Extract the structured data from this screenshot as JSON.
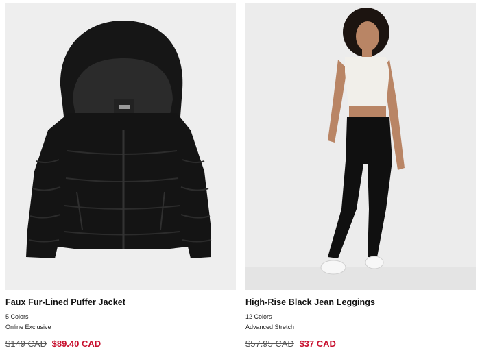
{
  "products": [
    {
      "name": "Faux Fur-Lined Puffer Jacket",
      "colors": "5 Colors",
      "tag": "Online Exclusive",
      "original_price": "$149 CAD",
      "sale_price": "$89.40 CAD",
      "image_icon": "puffer-jacket-image"
    },
    {
      "name": "High-Rise Black Jean Leggings",
      "colors": "12 Colors",
      "tag": "Advanced Stretch",
      "original_price": "$57.95 CAD",
      "sale_price": "$37 CAD",
      "image_icon": "model-leggings-image"
    }
  ],
  "colors": {
    "sale_red": "#c8102e",
    "image_background": "#eeeeee",
    "text": "#111111"
  }
}
